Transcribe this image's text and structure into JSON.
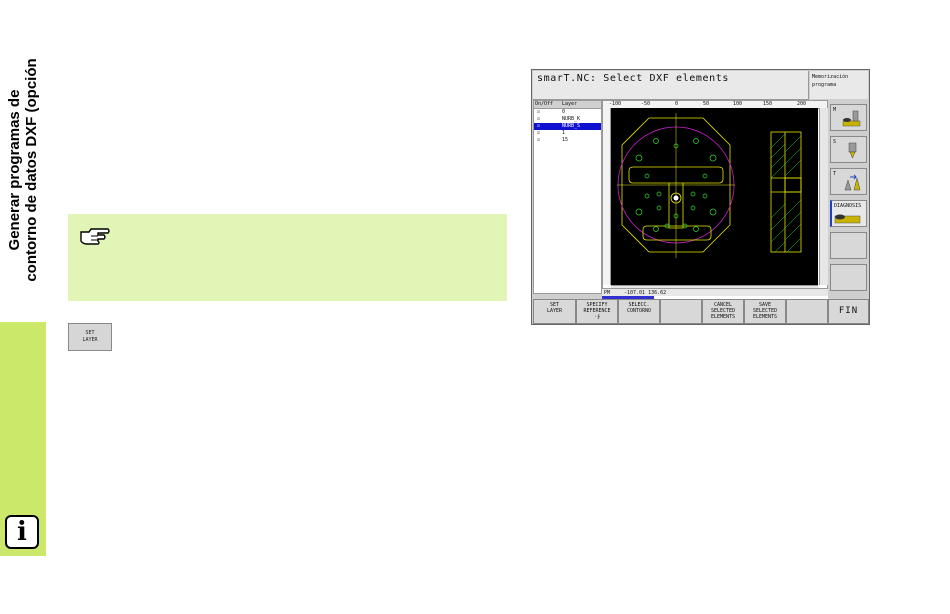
{
  "sidebar": {
    "title_line1": "Generar programas de",
    "title_line2": "contorno de datos DXF (opción",
    "info_icon": "i"
  },
  "note": {
    "icon": "pointing-hand-icon"
  },
  "softkey_reference": {
    "line1": "SET",
    "line2": "LAYER"
  },
  "screen": {
    "title": "smarT.NC: Select DXF elements",
    "mode_line1": "Memorización",
    "mode_line2": "programa",
    "layer_table": {
      "col_onoff": "On/Off",
      "col_layer": "Layer",
      "rows": [
        {
          "check": "☑",
          "name": "0"
        },
        {
          "check": "☑",
          "name": "NURB_K"
        },
        {
          "check": "☑",
          "name": "NURB_S"
        },
        {
          "check": "☑",
          "name": "1"
        },
        {
          "check": "☑",
          "name": "15"
        }
      ],
      "selected_index": 2
    },
    "ruler_ticks": [
      "-100",
      "-50",
      "0",
      "50",
      "100",
      "150",
      "200"
    ],
    "status": {
      "label": "PM",
      "coords": "-107.01  136.62"
    },
    "progress_fraction": 0.23,
    "right_buttons": [
      {
        "label": "M"
      },
      {
        "label": "S"
      },
      {
        "label": "T"
      },
      {
        "label": "DIAGNOSIS"
      },
      {
        "label": ""
      },
      {
        "label": ""
      }
    ],
    "softkeys": [
      {
        "l1": "",
        "l2": "SET",
        "l3": "LAYER"
      },
      {
        "l1": "SPECIFY",
        "l2": "REFERENCE",
        "l3": "·∱"
      },
      {
        "l1": "",
        "l2": "SELECC.",
        "l3": "CONTORNO"
      },
      {
        "l1": "",
        "l2": "",
        "l3": ""
      },
      {
        "l1": "CANCEL",
        "l2": "SELECTED",
        "l3": "ELEMENTS"
      },
      {
        "l1": "SAVE",
        "l2": "SELECTED",
        "l3": "ELEMENTS"
      },
      {
        "l1": "",
        "l2": "",
        "l3": ""
      },
      {
        "l1": "FIN",
        "l2": "",
        "l3": ""
      }
    ]
  },
  "colors": {
    "sidebar_green": "#cbe86b",
    "note_background": "#e1f5b6",
    "canvas_background": "#000000",
    "contour_yellow": "#e8e800",
    "contour_green": "#30e030",
    "circle_magenta": "#d020d0",
    "selection_blue": "#1010d0"
  }
}
